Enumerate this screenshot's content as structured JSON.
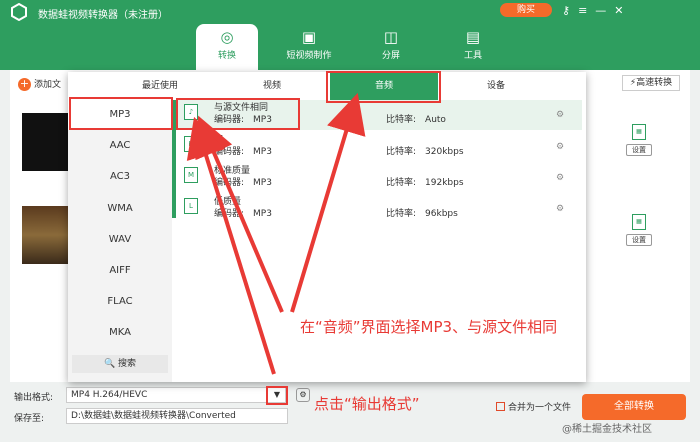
{
  "app": {
    "title": "数据蛙视频转换器（未注册）",
    "buy": "购买"
  },
  "nav": [
    {
      "label": "转换",
      "icon": "convert-icon"
    },
    {
      "label": "短视频制作",
      "icon": "tv-icon"
    },
    {
      "label": "分屏",
      "icon": "split-icon"
    },
    {
      "label": "工具",
      "icon": "toolbox-icon"
    }
  ],
  "toolbar": {
    "add_file": "添加文",
    "speed": "高速转换"
  },
  "popup": {
    "tabs": [
      "最近使用",
      "视频",
      "音频",
      "设备"
    ],
    "formats": [
      "MP3",
      "AAC",
      "AC3",
      "WMA",
      "WAV",
      "AIFF",
      "FLAC",
      "MKA"
    ],
    "search": "搜索",
    "presets": [
      {
        "name": "与源文件相同",
        "encoder": "编码器:　MP3",
        "bitrate": "比特率:　Auto"
      },
      {
        "name": "高",
        "encoder": "编码器:　MP3",
        "bitrate": "比特率:　320kbps"
      },
      {
        "name": "标准质量",
        "encoder": "编码器:　MP3",
        "bitrate": "比特率:　192kbps"
      },
      {
        "name": "低质量",
        "encoder": "编码器:　MP3",
        "bitrate": "比特率:　96kbps"
      }
    ]
  },
  "file_settings": "设置",
  "bottom": {
    "output_label": "输出格式:",
    "output_value": "MP4 H.264/HEVC",
    "save_label": "保存至:",
    "save_path": "D:\\数据蛙\\数据蛙视频转换器\\Converted",
    "merge": "合并为一个文件",
    "convert_all": "全部转换"
  },
  "annotations": {
    "main": "在“音频”界面选择MP3、与源文件相同",
    "output": "点击“输出格式”"
  },
  "watermark": "@稀土掘金技术社区",
  "colors": {
    "brand": "#2e9e5f",
    "accent": "#f56a2a",
    "annotation": "#e83a35"
  }
}
